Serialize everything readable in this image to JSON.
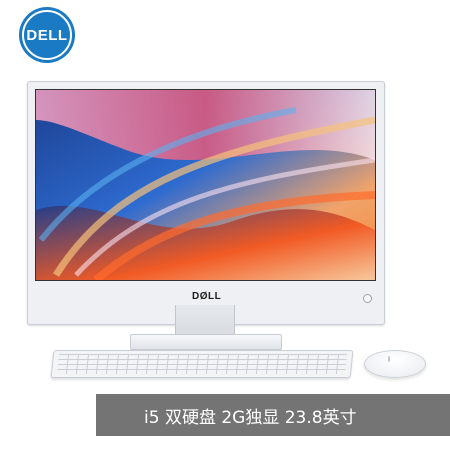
{
  "brand": {
    "logo_text": "DELL",
    "chin_text": "DØLL"
  },
  "banner": {
    "text": "i5 双硬盘 2G独显 23.8英寸"
  },
  "colors": {
    "brand_blue": "#1a7ac3",
    "banner_gray": "#747474",
    "product_white": "#eef0f3"
  },
  "icons": [
    "dell-logo-icon",
    "webcam-icon"
  ]
}
